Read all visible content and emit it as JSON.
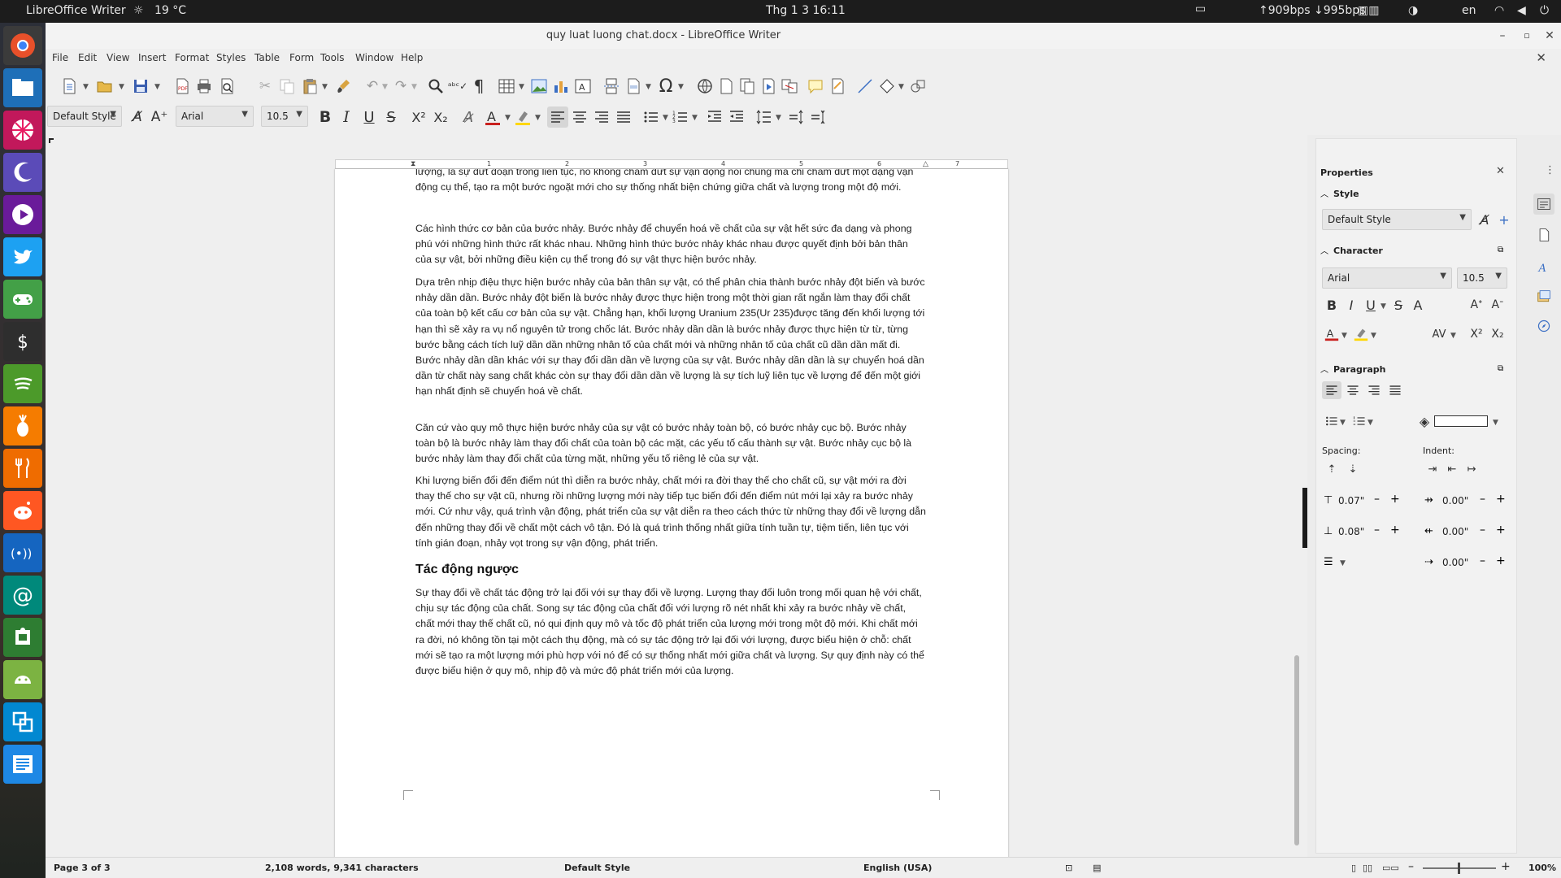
{
  "system_bar": {
    "app_name": "LibreOffice Writer",
    "weather": "19 °C",
    "clock": "Thg 1 3  16:11",
    "network_speed": "↑909bps ↓995bps",
    "language": "en"
  },
  "window": {
    "title": "quy luat luong chat.docx - LibreOffice Writer"
  },
  "menu": [
    "File",
    "Edit",
    "View",
    "Insert",
    "Format",
    "Styles",
    "Table",
    "Form",
    "Tools",
    "Window",
    "Help"
  ],
  "formatting": {
    "paragraph_style": "Default Style",
    "font_name": "Arial",
    "font_size": "10.5"
  },
  "ruler": [
    "1",
    "2",
    "3",
    "4",
    "5",
    "6",
    "7"
  ],
  "document": {
    "paragraphs": [
      "lượng, là sự đứt đoạn trong liên tục, nó không chấm dứt sự vận động nói chung mà chỉ chấm dứt một dạng vận động cụ thể, tạo ra một bước ngoặt mới cho sự thống nhất biện chứng giữa chất và lượng trong một độ mới.",
      "Các hình thức cơ bản của bước nhảy. Bước nhảy để chuyển hoá về chất của sự vật hết sức đa dạng và phong phú với những hình thức rất khác nhau. Những hình thức bước nhảy khác nhau được quyết định bởi bản thân của sự vật, bởi những điều kiện cụ thể trong đó sự vật thực hiện bước nhảy.",
      "Dựa trên nhịp điệu thực hiện bước nhảy của bản thân sự vật, có thể phân chia thành bước nhảy đột biến và bước nhảy dần dần. Bước nhảy đột biến là bước nhảy được thực hiện trong một thời gian rất ngắn làm thay đổi chất của toàn bộ kết cấu cơ bản của sự vật. Chẳng hạn, khối lượng Uranium 235(Ur 235)được tăng đến khối lượng tới hạn thì sẽ xảy ra vụ nổ nguyên tử trong chốc lát. Bước nhảy dần dần là bước nhảy được thực hiện từ từ, từng bước bằng cách tích luỹ dần dần những nhân tố của chất mới và những nhân tố của chất cũ dần dần mất đi. Bước nhảy dần dần khác với sự thay đổi dần dần về lượng của sự vật. Bước nhảy dần dần là sự chuyển hoá dần dần từ chất này sang chất khác còn sự thay đổi dần dần về lượng là sự tích luỹ liên tục về lượng để đến một giới hạn nhất định sẽ chuyển hoá về chất.",
      "Căn cứ vào quy mô thực hiện bước nhảy của sự vật có bước nhảy toàn bộ, có bước nhảy cục bộ. Bước nhảy toàn bộ là bước nhảy làm thay đổi chất của toàn bộ các mặt, các yếu tố cấu thành sự vật. Bước nhảy cục bộ là bước nhảy làm thay đổi chất của từng mặt, những yếu tố riêng lẻ của sự vật.",
      "Khi lượng biến đổi đến điểm nút thì diễn ra bước nhảy, chất mới ra đời thay thế cho chất cũ, sự vật mới ra đời thay thế cho sự vật cũ, nhưng rồi những lượng mới này tiếp tục biến đổi đến điểm nút mới lại xảy ra bước nhảy mới. Cứ như vậy, quá trình vận động, phát triển của sự vật diễn ra theo cách thức từ những thay đổi về lượng dẫn đến những thay đổi về chất một cách vô tận. Đó là quá trình thống nhất giữa tính tuần tự, tiệm tiến, liên tục với tính gián đoạn, nhảy vọt trong sự vận động, phát triển."
    ],
    "heading": "Tác động ngược",
    "paragraph_after_heading": "Sự thay đổi về chất tác động trở lại đối với sự thay đổi về lượng. Lượng thay đổi luôn trong mối quan hệ với chất, chịu sự tác động của chất. Song sự tác động của chất đối với lượng rõ nét nhất khi xảy ra bước nhảy về chất, chất mới thay thế chất cũ, nó qui định quy mô và tốc độ phát triển của lượng mới trong một độ mới. Khi chất mới ra đời, nó không tồn tại một cách thụ động, mà có sự tác động trở lại đối với lượng, được biểu hiện ở chỗ: chất mới sẽ tạo ra một lượng mới phù hợp với nó để có sự thống nhất mới giữa chất và lượng. Sự quy định này có thể được biểu hiện ở quy mô, nhịp độ và mức độ phát triển mới của lượng."
  },
  "sidebar": {
    "title": "Properties",
    "style_section": "Style",
    "style_value": "Default Style",
    "character_section": "Character",
    "font_value": "Arial",
    "size_value": "10.5",
    "paragraph_section": "Paragraph",
    "spacing_label": "Spacing:",
    "indent_label": "Indent:",
    "above_spacing": "0.07\"",
    "below_spacing": "0.08\"",
    "before_indent": "0.00\"",
    "after_indent": "0.00\"",
    "first_line_indent": "0.00\""
  },
  "status": {
    "page": "Page 3 of 3",
    "word_count": "2,108 words, 9,341 characters",
    "page_style": "Default Style",
    "language": "English (USA)",
    "zoom": "100%"
  },
  "colors": {
    "font_color": "#c9211e",
    "highlight_color": "#ffd700",
    "dock_chrome": "#e8502a",
    "dock_twitter": "#1da1f2",
    "dock_spotify": "#4c9a2a"
  }
}
